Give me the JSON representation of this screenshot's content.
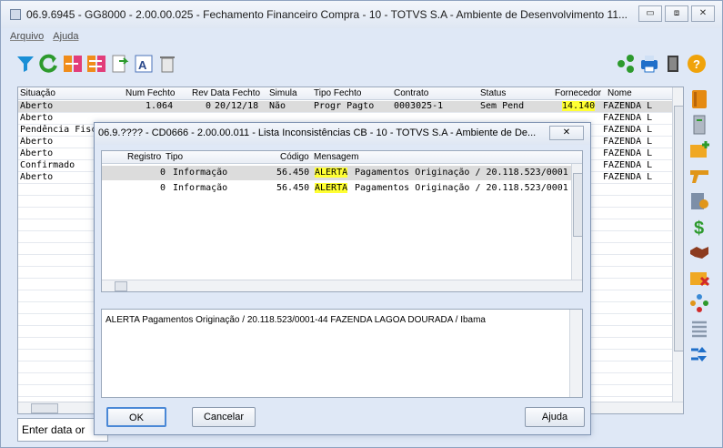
{
  "window": {
    "title": "06.9.6945 - GG8000 - 2.00.00.025 - Fechamento Financeiro Compra - 10 - TOTVS S.A - Ambiente de Desenvolvimento 11...",
    "minimize": "▭",
    "maximize": "⧈",
    "close": "✕"
  },
  "menu": [
    "Arquivo",
    "Ajuda"
  ],
  "toolbar_icons": [
    "filter-icon",
    "refresh-icon",
    "collapse-icon",
    "expand-icon",
    "export-icon",
    "text-format-icon",
    "trash-icon",
    "share-icon",
    "print-icon",
    "exit-door-icon",
    "help-icon"
  ],
  "main_grid": {
    "columns": [
      "Situação",
      "Num Fechto",
      "Rev Data Fechto",
      "Simula",
      "Tipo Fechto",
      "Contrato",
      "Status",
      "Fornecedor",
      "Nome"
    ],
    "rows": [
      {
        "situacao": "Aberto",
        "num": "1.064",
        "rev": "0",
        "data": "20/12/18",
        "simula": "Não",
        "tipo": "Progr Pagto",
        "contrato": "0003025-1",
        "status": "Sem Pend",
        "fornecedor": "14.140",
        "nome": "FAZENDA L"
      },
      {
        "situacao": "Aberto",
        "num": "",
        "rev": "",
        "data": "",
        "simula": "",
        "tipo": "",
        "contrato": "",
        "status": "",
        "fornecedor": "",
        "nome": "FAZENDA L"
      },
      {
        "situacao": "Pendência Fisc",
        "num": "",
        "rev": "",
        "data": "",
        "simula": "",
        "tipo": "",
        "contrato": "",
        "status": "",
        "fornecedor": "",
        "nome": "FAZENDA L"
      },
      {
        "situacao": "Aberto",
        "num": "",
        "rev": "",
        "data": "",
        "simula": "",
        "tipo": "",
        "contrato": "",
        "status": "",
        "fornecedor": "",
        "nome": "FAZENDA L"
      },
      {
        "situacao": "Aberto",
        "num": "",
        "rev": "",
        "data": "",
        "simula": "",
        "tipo": "",
        "contrato": "",
        "status": "",
        "fornecedor": "",
        "nome": "FAZENDA L"
      },
      {
        "situacao": "Confirmado",
        "num": "",
        "rev": "",
        "data": "",
        "simula": "",
        "tipo": "",
        "contrato": "",
        "status": "",
        "fornecedor": "",
        "nome": "FAZENDA L"
      },
      {
        "situacao": "Aberto",
        "num": "",
        "rev": "",
        "data": "",
        "simula": "",
        "tipo": "",
        "contrato": "",
        "status": "",
        "fornecedor": "",
        "nome": "FAZENDA L"
      }
    ]
  },
  "status_bar": "Enter data or",
  "sidebar_icons": [
    "book-icon",
    "document-icon",
    "folder-add-icon",
    "pistol-icon",
    "report-icon",
    "dollar-icon",
    "handshake-icon",
    "folder-remove-icon",
    "network-icon",
    "list-icon",
    "sort-icon"
  ],
  "dialog": {
    "title": "06.9.???? - CD0666 - 2.00.00.011 - Lista Inconsistências CB - 10 - TOTVS S.A - Ambiente de De...",
    "close": "✕",
    "columns": [
      "Registro",
      "Tipo",
      "Código",
      "Mensagem"
    ],
    "rows": [
      {
        "registro": "0",
        "tipo": "Informação",
        "codigo": "56.450",
        "alerta": "ALERTA",
        "mensagem": "Pagamentos Originação / 20.118.523/0001"
      },
      {
        "registro": "0",
        "tipo": "Informação",
        "codigo": "56.450",
        "alerta": "ALERTA",
        "mensagem": "Pagamentos Originação / 20.118.523/0001"
      }
    ],
    "detail": "ALERTA Pagamentos Originação / 20.118.523/0001-44 FAZENDA LAGOA DOURADA / Ibama",
    "ok_label": "OK",
    "cancel_label": "Cancelar",
    "help_label": "Ajuda"
  }
}
